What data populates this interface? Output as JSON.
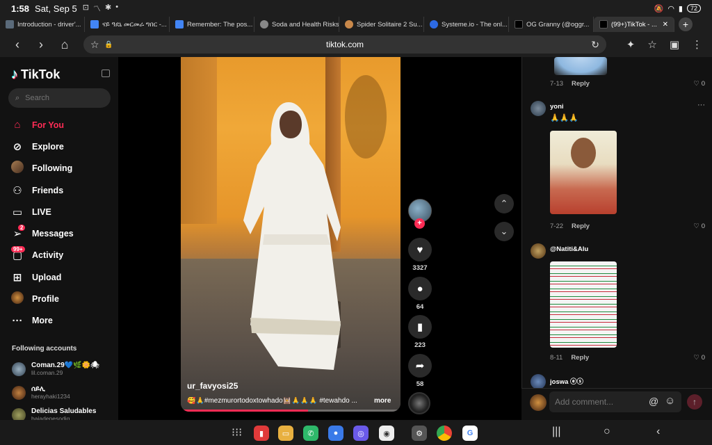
{
  "status": {
    "time": "1:58",
    "date": "Sat, Sep 5",
    "battery": "72"
  },
  "tabs": [
    {
      "title": "Introduction - driver'...",
      "color": "#5a6a7a"
    },
    {
      "title": "ናይ ዓደኒ መርመራ ግበር -...",
      "color": "#4285f4"
    },
    {
      "title": "Remember: The pos...",
      "color": "#4285f4"
    },
    {
      "title": "Soda and Health Risks",
      "color": "#888888"
    },
    {
      "title": "Spider Solitaire 2 Su...",
      "color": "#c8884a"
    },
    {
      "title": "Systeme.io - The onl...",
      "color": "#2d6ae3"
    },
    {
      "title": "OG Granny (@oggr...",
      "color": "#000000"
    },
    {
      "title": "(99+)TikTok - ...",
      "color": "#000000"
    }
  ],
  "address": {
    "url": "tiktok.com"
  },
  "sidebar": {
    "logo": "TikTok",
    "search_placeholder": "Search",
    "items": [
      {
        "label": "For You"
      },
      {
        "label": "Explore"
      },
      {
        "label": "Following"
      },
      {
        "label": "Friends"
      },
      {
        "label": "LIVE"
      },
      {
        "label": "Messages",
        "badge": "2"
      },
      {
        "label": "Activity",
        "badge": "99+"
      },
      {
        "label": "Upload"
      },
      {
        "label": "Profile"
      },
      {
        "label": "More"
      }
    ],
    "following_header": "Following accounts",
    "following": [
      {
        "name": "Coman.29💙🌿🌼🕷",
        "handle": "lil.coman.29"
      },
      {
        "name": "ሰይሊ",
        "handle": "herayhaki1234"
      },
      {
        "name": "Delicias Saludables",
        "handle": "bajadepesodig"
      }
    ]
  },
  "video": {
    "author": "ur_favyosi25",
    "caption": "🥰🙏#mezmurortodoxtowhado🕍🙏🙏🙏 #tewahdo ...",
    "more": "more",
    "progress": 0.58
  },
  "actions": {
    "likes": "3327",
    "comments": "64",
    "saves": "223",
    "shares": "58"
  },
  "comments": [
    {
      "date": "7-13",
      "reply": "Reply",
      "likes": "0"
    },
    {
      "user": "yoni",
      "text": "🙏🙏🙏",
      "date": "7-22",
      "reply": "Reply",
      "likes": "0"
    },
    {
      "user": "@Natiti&Alu",
      "date": "8-11",
      "reply": "Reply",
      "likes": "0"
    },
    {
      "user": "joswa ⓔⓢ"
    }
  ],
  "add_comment": {
    "placeholder": "Add comment..."
  },
  "icons": {
    "back": "arrow-left-icon",
    "forward": "arrow-right-icon",
    "home": "home-icon",
    "for_you": "home-icon",
    "explore": "compass-icon",
    "like": "heart-icon"
  },
  "colors": {
    "accent": "#fe2c55",
    "panel": "#121212"
  }
}
